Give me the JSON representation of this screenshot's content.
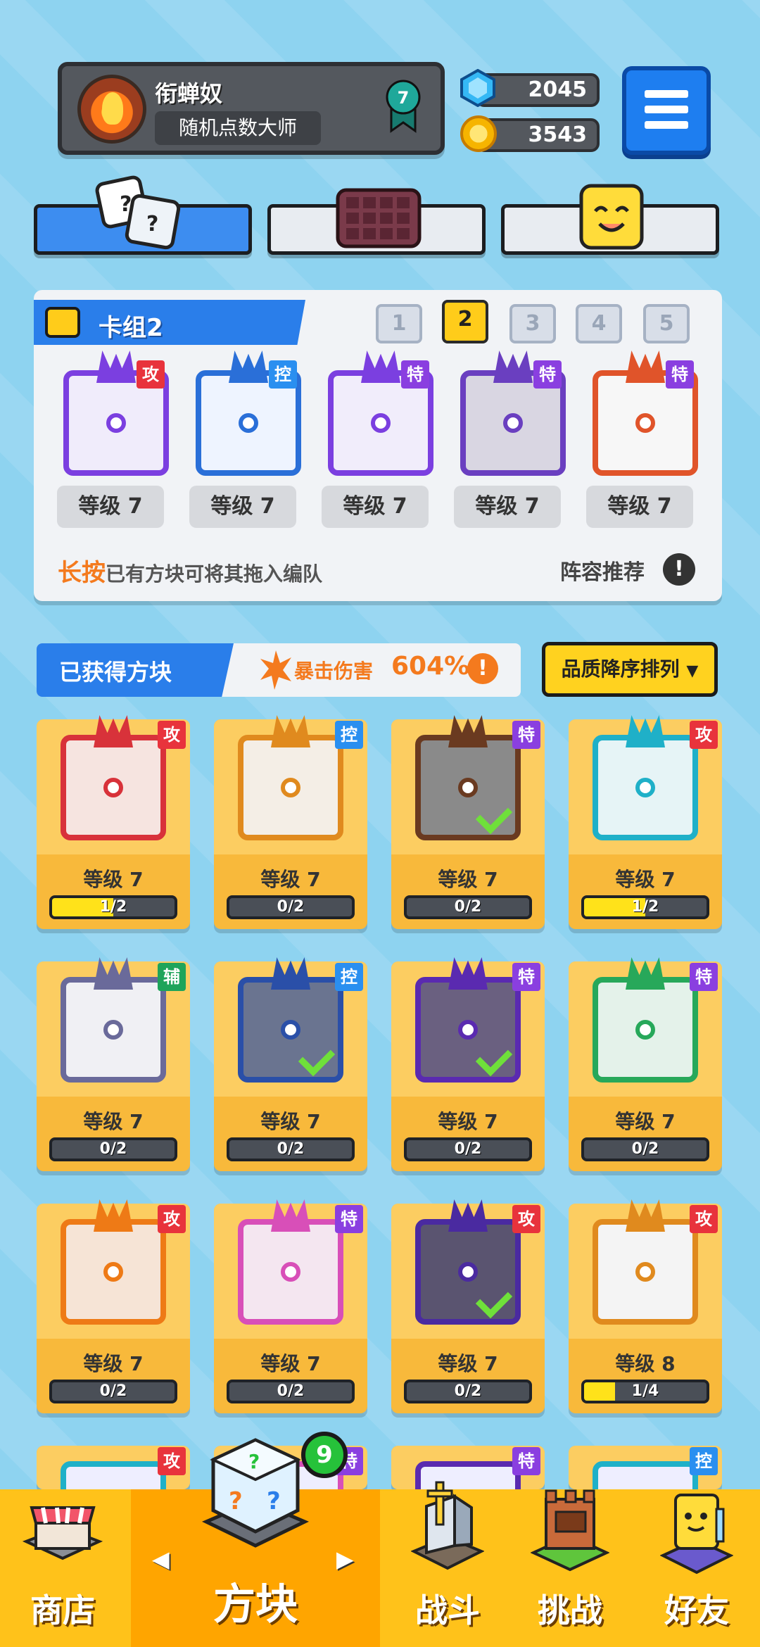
{
  "player": {
    "name": "衔蝉奴",
    "title": "随机点数大师",
    "rank": "7"
  },
  "currency": {
    "gems": "2045",
    "coins": "3543",
    "gem_icon": "gem-icon",
    "coin_icon": "coin-icon"
  },
  "deck": {
    "title": "卡组2",
    "numbers": [
      "1",
      "2",
      "3",
      "4",
      "5"
    ],
    "active_index": 1,
    "slots": [
      {
        "tag": "攻",
        "level": "等级 7"
      },
      {
        "tag": "控",
        "level": "等级 7"
      },
      {
        "tag": "特",
        "level": "等级 7"
      },
      {
        "tag": "特",
        "level": "等级 7"
      },
      {
        "tag": "特",
        "level": "等级 7"
      }
    ],
    "hint_accent": "长按",
    "hint_text": "已有方块可将其拖入编队",
    "recommend": "阵容推荐",
    "alert": "!"
  },
  "owned": {
    "title": "已获得方块",
    "crit_label": "暴击伤害",
    "crit_value": "604%",
    "alert": "!",
    "sort": "品质降序排列",
    "sort_arrow": "▼",
    "check_mark": "✓",
    "cards": [
      {
        "tag": "攻",
        "level": "等级 7",
        "progress": "1/2",
        "fill": 0.5,
        "equipped": false
      },
      {
        "tag": "控",
        "level": "等级 7",
        "progress": "0/2",
        "fill": 0,
        "equipped": false
      },
      {
        "tag": "特",
        "level": "等级 7",
        "progress": "0/2",
        "fill": 0,
        "equipped": true
      },
      {
        "tag": "攻",
        "level": "等级 7",
        "progress": "1/2",
        "fill": 0.5,
        "equipped": false
      },
      {
        "tag": "辅",
        "level": "等级 7",
        "progress": "0/2",
        "fill": 0,
        "equipped": false
      },
      {
        "tag": "控",
        "level": "等级 7",
        "progress": "0/2",
        "fill": 0,
        "equipped": true
      },
      {
        "tag": "特",
        "level": "等级 7",
        "progress": "0/2",
        "fill": 0,
        "equipped": true
      },
      {
        "tag": "特",
        "level": "等级 7",
        "progress": "0/2",
        "fill": 0,
        "equipped": false
      },
      {
        "tag": "攻",
        "level": "等级 7",
        "progress": "0/2",
        "fill": 0,
        "equipped": false
      },
      {
        "tag": "特",
        "level": "等级 7",
        "progress": "0/2",
        "fill": 0,
        "equipped": false
      },
      {
        "tag": "攻",
        "level": "等级 7",
        "progress": "0/2",
        "fill": 0,
        "equipped": true
      },
      {
        "tag": "攻",
        "level": "等级 8",
        "progress": "1/4",
        "fill": 0.25,
        "equipped": false
      }
    ],
    "next_row_tags": [
      "攻",
      "特",
      "特",
      "控"
    ]
  },
  "nav": {
    "shop": "商店",
    "blocks": "方块",
    "battle": "战斗",
    "challenge": "挑战",
    "friends": "好友",
    "blocks_badge": "9",
    "arrow_left": "◀",
    "arrow_right": "▶"
  },
  "colors": {
    "攻": "#e8333c",
    "控": "#2a8ff0",
    "特": "#8a3fe0",
    "辅": "#1fa45a",
    "accent_blue": "#2a7eea",
    "accent_orange": "#f47a1e",
    "nav_yellow": "#ffc21a"
  }
}
